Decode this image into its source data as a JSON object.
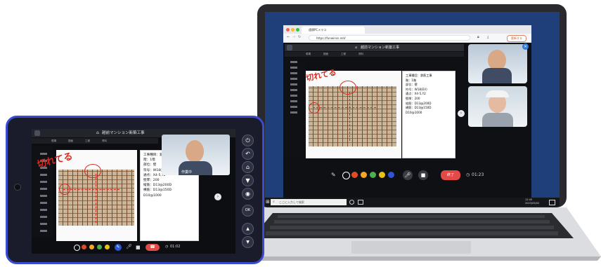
{
  "browser": {
    "tab_title": "遠隔PCメラコ",
    "url": "https://funwinsn.net/",
    "update_button": "更新する"
  },
  "app": {
    "project_title": "越前マンション新築工事",
    "nav_items": [
      "現場",
      "図面",
      "工程",
      "資料"
    ]
  },
  "annotation": {
    "text": "切れてる"
  },
  "inspection_info": [
    "工事種目：鉄筋工事",
    "階：1階",
    "部位：壁",
    "符号：W18(EV)",
    "通点：X4-5,Y2",
    "壁厚：200",
    "縦筋：D13@200D",
    "横筋：D13@150D",
    "D10@1000"
  ],
  "tablet_info": [
    "工事種目：鉄筋工事",
    "階：1階",
    "部位：壁",
    "符号：W18(EV)",
    "通点：X4-5,Y2",
    "壁厚：200",
    "縦筋：D13@200D",
    "横筋：D13@150D",
    "D10@1000"
  ],
  "call": {
    "end_label": "終了",
    "timer": "01:23"
  },
  "tablet_call": {
    "timer": "01:02",
    "caption": "作業中"
  },
  "pen_colors": [
    "#000000",
    "#e24a24",
    "#f5a623",
    "#4caf50",
    "#e8c21a",
    "#2c56d6"
  ],
  "taskbar": {
    "search_placeholder": "ここに入力して検索",
    "time": "12:45",
    "date": "2023/05/02"
  },
  "hardware_buttons": {
    "ok_label": "OK"
  },
  "icons": [
    "power-icon",
    "back-icon",
    "home-icon",
    "flashlight-icon",
    "camera-icon",
    "up-arrow-icon",
    "down-arrow-icon",
    "mic-icon",
    "video-icon",
    "pen-icon",
    "clock-icon",
    "search-icon",
    "windows-icon"
  ]
}
